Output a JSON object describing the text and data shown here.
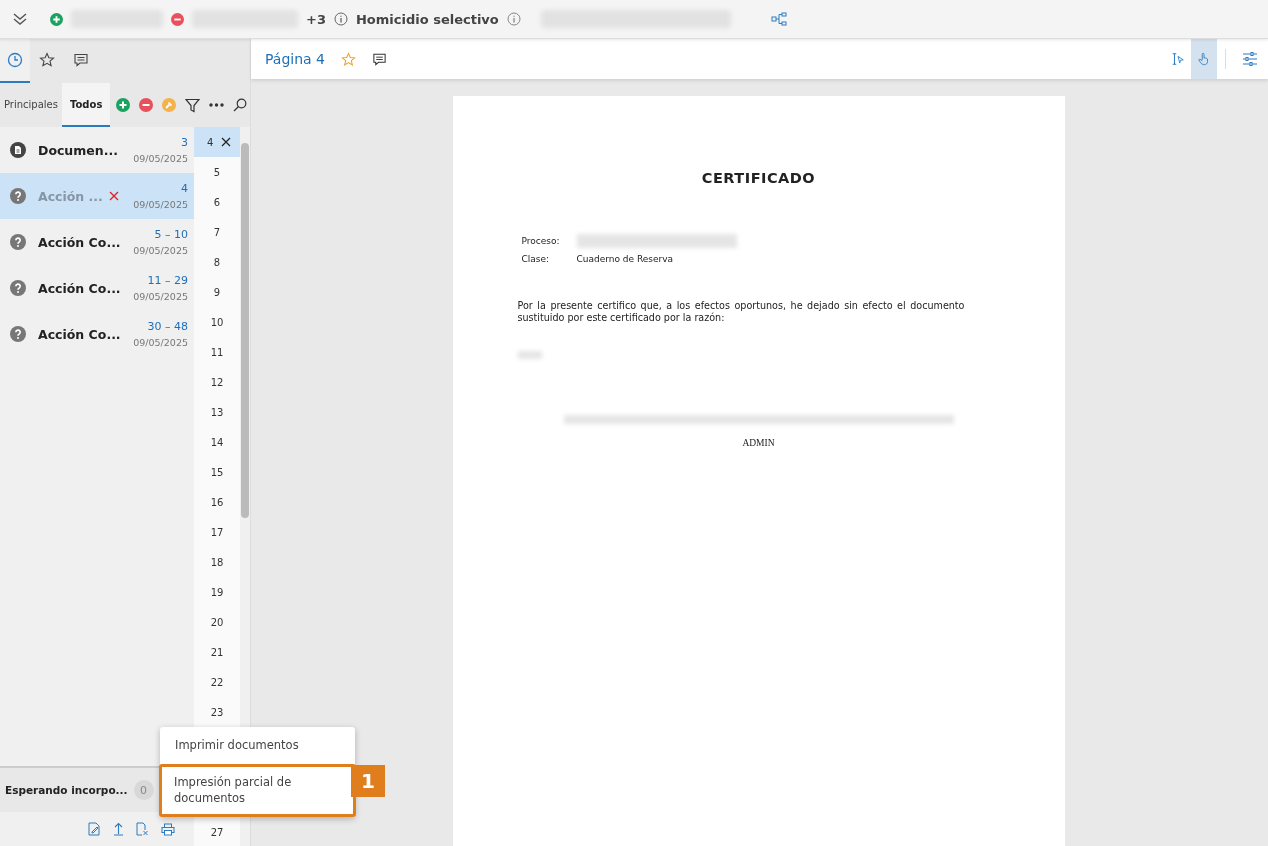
{
  "top_bar": {
    "extra_count": "+3",
    "case_type": "Homicidio selectivo"
  },
  "left_tabs": [
    {
      "kind": "history",
      "selected": true
    },
    {
      "kind": "favorites",
      "selected": false
    },
    {
      "kind": "comments",
      "selected": false
    }
  ],
  "sub_tabs": [
    {
      "label": "Principales",
      "selected": false
    },
    {
      "label": "Todos",
      "selected": true
    }
  ],
  "documents": [
    {
      "kind": "document",
      "title": "Documen...",
      "pages": "3",
      "date": "09/05/2025",
      "selected": false,
      "removed": false
    },
    {
      "kind": "unknown",
      "title": "Acción ...",
      "pages": "4",
      "date": "09/05/2025",
      "selected": true,
      "removed": true
    },
    {
      "kind": "unknown",
      "title": "Acción Co...",
      "pages": "5 – 10",
      "date": "09/05/2025",
      "selected": false,
      "removed": false
    },
    {
      "kind": "unknown",
      "title": "Acción Co...",
      "pages": "11 – 29",
      "date": "09/05/2025",
      "selected": false,
      "removed": false
    },
    {
      "kind": "unknown",
      "title": "Acción Co...",
      "pages": "30 – 48",
      "date": "09/05/2025",
      "selected": false,
      "removed": false
    }
  ],
  "page_numbers": [
    {
      "label": "4",
      "selected": true
    },
    {
      "label": "5",
      "selected": false
    },
    {
      "label": "6",
      "selected": false
    },
    {
      "label": "7",
      "selected": false
    },
    {
      "label": "8",
      "selected": false
    },
    {
      "label": "9",
      "selected": false
    },
    {
      "label": "10",
      "selected": false
    },
    {
      "label": "11",
      "selected": false
    },
    {
      "label": "12",
      "selected": false
    },
    {
      "label": "13",
      "selected": false
    },
    {
      "label": "14",
      "selected": false
    },
    {
      "label": "15",
      "selected": false
    },
    {
      "label": "16",
      "selected": false
    },
    {
      "label": "17",
      "selected": false
    },
    {
      "label": "18",
      "selected": false
    },
    {
      "label": "19",
      "selected": false
    },
    {
      "label": "20",
      "selected": false
    },
    {
      "label": "21",
      "selected": false
    },
    {
      "label": "22",
      "selected": false
    },
    {
      "label": "23",
      "selected": false
    },
    {
      "label": "27",
      "selected": false
    }
  ],
  "waiting": {
    "label": "Esperando incorpo...",
    "count": "0"
  },
  "viewer": {
    "title": "Página 4",
    "tools": [
      {
        "kind": "text-select",
        "selected": false
      },
      {
        "kind": "hand",
        "selected": true
      }
    ]
  },
  "document_page": {
    "heading": "CERTIFICADO",
    "fields": [
      {
        "label": "Proceso:"
      },
      {
        "label": "Clase:",
        "value": "Cuaderno de Reserva"
      }
    ],
    "body": "Por la presente certifico que, a los efectos oportunos, he dejado sin efecto el documento sustituido por este certificado por la razón:",
    "signature": "ADMIN"
  },
  "print_menu": {
    "items": [
      {
        "label": "Imprimir documentos",
        "highlighted": false
      },
      {
        "label": "Impresión parcial de documentos",
        "highlighted": true
      }
    ],
    "callout": "1"
  }
}
